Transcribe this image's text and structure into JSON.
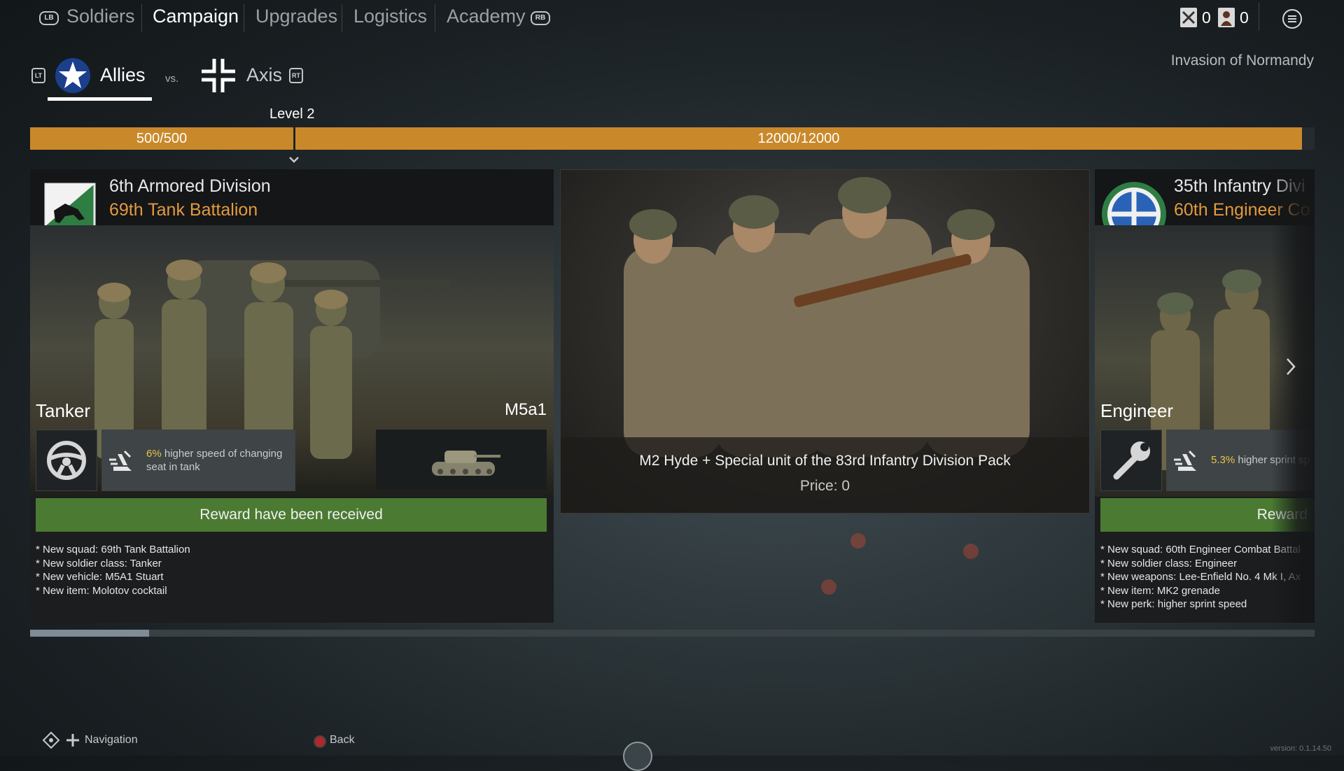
{
  "nav": {
    "lb": "LB",
    "rb": "RB",
    "tabs": [
      "Soldiers",
      "Campaign",
      "Upgrades",
      "Logistics",
      "Academy"
    ],
    "active_tab": "Campaign",
    "counter1": "0",
    "counter2": "0"
  },
  "faction": {
    "lt": "LT",
    "rt": "RT",
    "allies": "Allies",
    "vs": "vs.",
    "axis": "Axis",
    "campaign_name": "Invasion of Normandy"
  },
  "progress": {
    "level_label": "Level 2",
    "segment1": "500/500",
    "segment2": "12000/12000",
    "segment1_fraction": 1.0,
    "segment2_fraction": 1.0
  },
  "cards": {
    "card1": {
      "division": "6th Armored Division",
      "unit": "69th Tank Battalion",
      "class_name": "Tanker",
      "vehicle": "M5a1",
      "perk_value": "6%",
      "perk_text": " higher speed of changing seat in tank",
      "reward_label": "Reward have been received",
      "desc": "* New squad: 69th Tank Battalion\n* New soldier class: Tanker\n* New vehicle: M5A1 Stuart\n* New item: Molotov cocktail"
    },
    "card2": {
      "title": "M2 Hyde + Special unit of the 83rd Infantry Division Pack",
      "price": "Price: 0"
    },
    "card3": {
      "division": "35th Infantry Divi",
      "unit": "60th Engineer Co",
      "class_name": "Engineer",
      "perk_value": "5.3%",
      "perk_text": " higher sprint sp",
      "reward_label": "Reward",
      "desc": "* New squad: 60th Engineer Combat Battal\n* New soldier class: Engineer\n* New weapons: Lee-Enfield No. 4 Mk I, Ax\n* New item: MK2 grenade\n* New perk: higher sprint speed"
    }
  },
  "footer": {
    "nav_label": "Navigation",
    "back_label": "Back",
    "version": "version: 0.1.14.50"
  },
  "colors": {
    "accent_orange": "#c9892a",
    "subtitle_orange": "#e39a3d",
    "reward_green": "#4b7a32",
    "perk_highlight": "#e9c44a"
  },
  "icons": [
    "menu-icon",
    "allies-star-icon",
    "axis-cross-icon",
    "steering-wheel-icon",
    "wrench-icon",
    "speed-perk-icon",
    "chevron-right-icon"
  ]
}
